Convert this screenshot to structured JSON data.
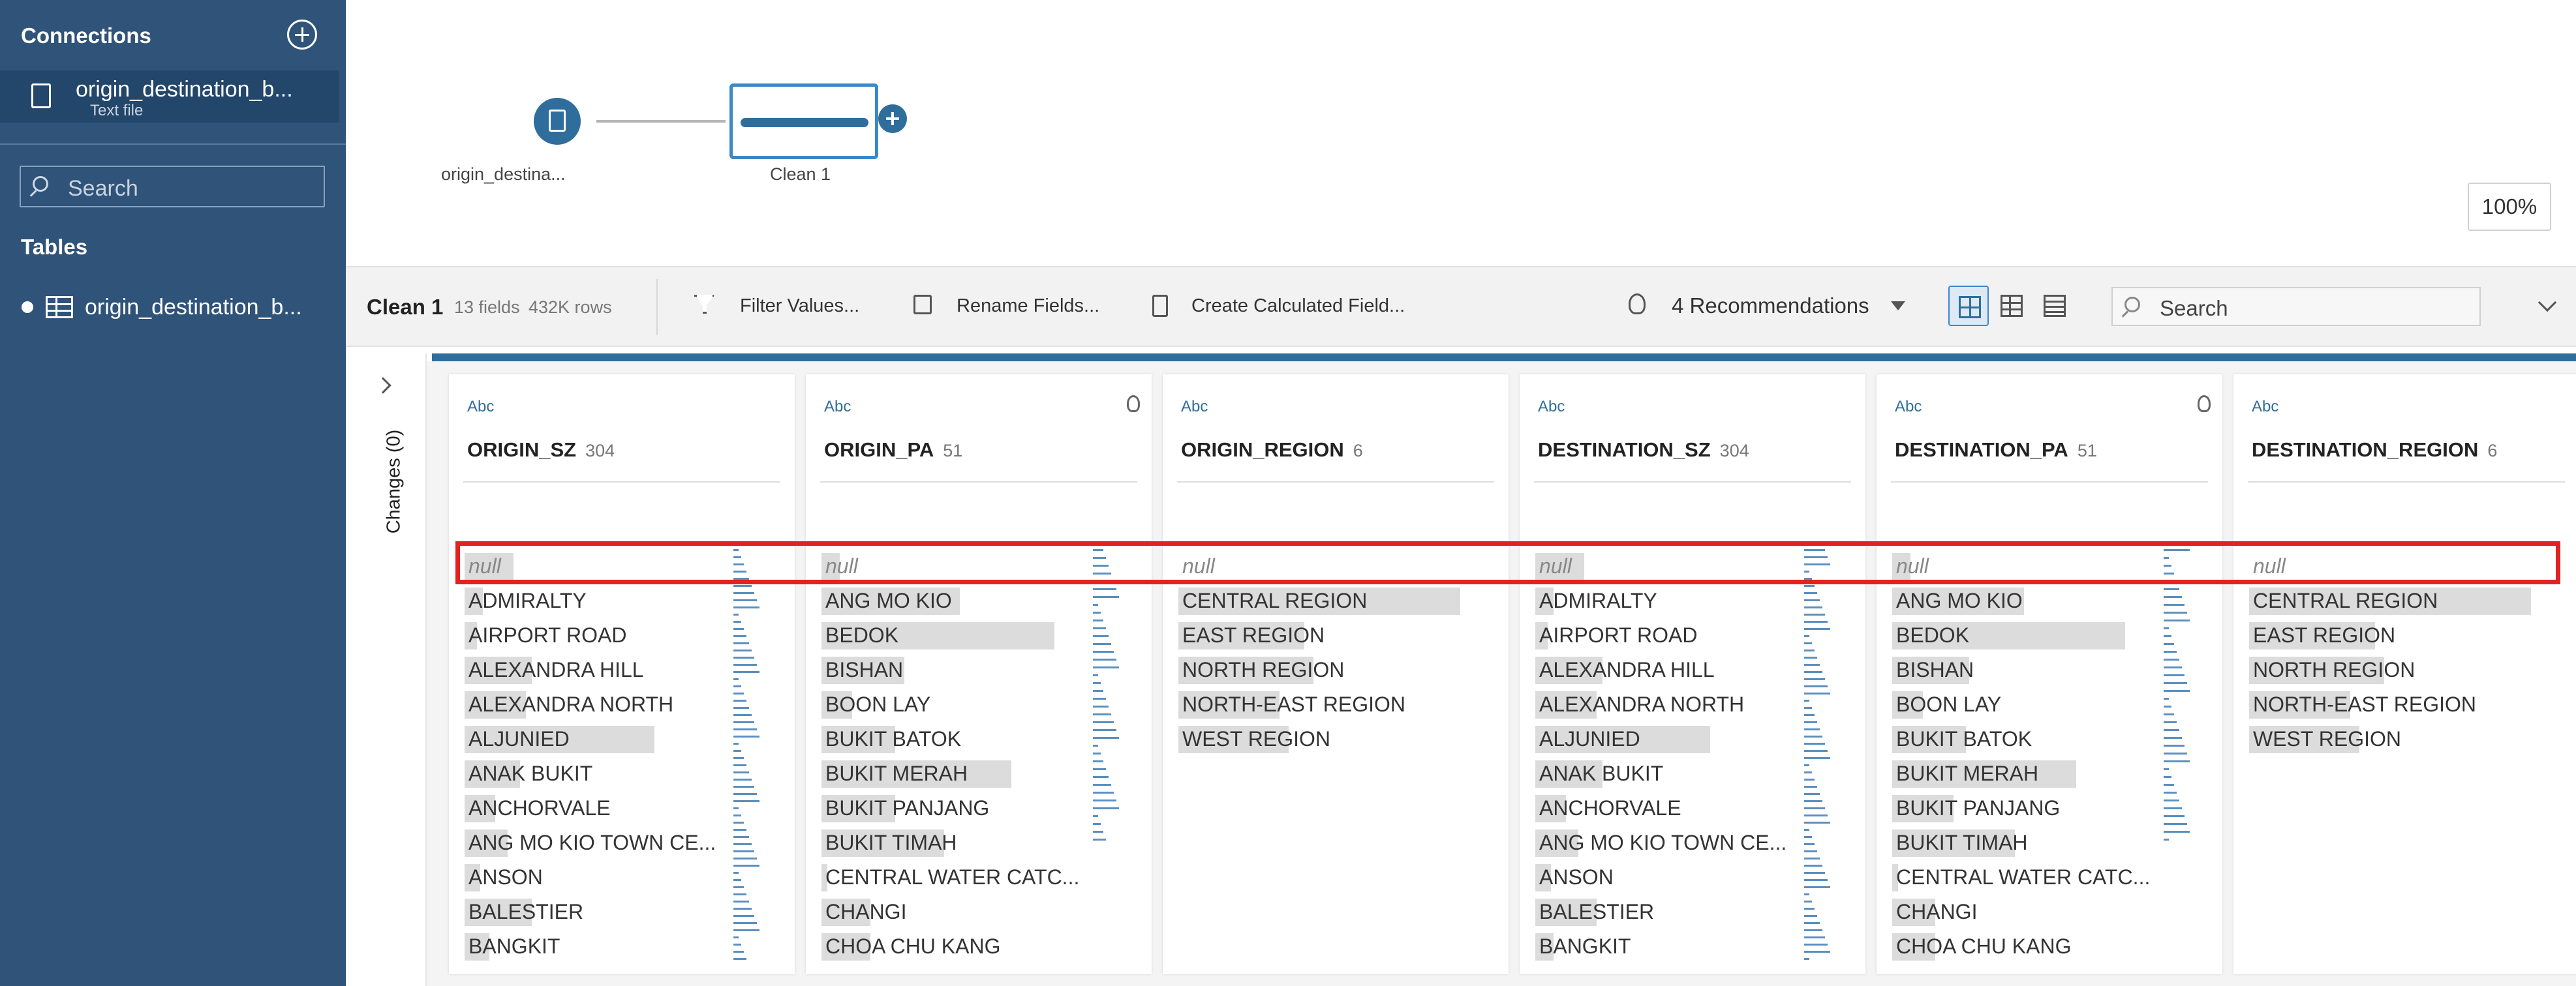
{
  "sidebar": {
    "connections_heading": "Connections",
    "connection_name": "origin_destination_b...",
    "connection_type": "Text file",
    "search_placeholder": "Search",
    "tables_heading": "Tables",
    "table_name": "origin_destination_b..."
  },
  "canvas": {
    "source_node_label": "origin_destina...",
    "clean_node_label": "Clean 1",
    "zoom": "100%"
  },
  "toolbar": {
    "step_name": "Clean 1",
    "fields": "13 fields",
    "rows": "432K rows",
    "filter_label": "Filter Values...",
    "rename_label": "Rename Fields...",
    "calc_label": "Create Calculated Field...",
    "recommendations_label": "4 Recommendations",
    "search_placeholder": "Search"
  },
  "changes": {
    "label": "Changes (0)"
  },
  "colors": {
    "sidebar": "#2f5379",
    "accent": "#2f6e9c",
    "highlight": "#e32121"
  },
  "fields": [
    {
      "type": "Abc",
      "name": "ORIGIN_SZ",
      "count": "304",
      "recommend": false,
      "values": [
        "null",
        "ADMIRALTY",
        "AIRPORT ROAD",
        "ALEXANDRA HILL",
        "ALEXANDRA NORTH",
        "ALJUNIED",
        "ANAK BUKIT",
        "ANCHORVALE",
        "ANG MO KIO TOWN CE...",
        "ANSON",
        "BALESTIER",
        "BANGKIT"
      ],
      "bars": [
        0.16,
        0.06,
        0.04,
        0.22,
        0.2,
        0.62,
        0.18,
        0.1,
        0.14,
        0.05,
        0.22,
        0.08
      ]
    },
    {
      "type": "Abc",
      "name": "ORIGIN_PA",
      "count": "51",
      "recommend": true,
      "values": [
        "null",
        "ANG MO KIO",
        "BEDOK",
        "BISHAN",
        "BOON LAY",
        "BUKIT BATOK",
        "BUKIT MERAH",
        "BUKIT PANJANG",
        "BUKIT TIMAH",
        "CENTRAL WATER CATC...",
        "CHANGI",
        "CHOA CHU KANG"
      ],
      "bars": [
        0.06,
        0.45,
        0.76,
        0.27,
        0.1,
        0.24,
        0.62,
        0.24,
        0.4,
        0.02,
        0.16,
        0.16
      ]
    },
    {
      "type": "Abc",
      "name": "ORIGIN_REGION",
      "count": "6",
      "recommend": false,
      "values": [
        "null",
        "CENTRAL REGION",
        "EAST REGION",
        "NORTH REGION",
        "NORTH-EAST REGION",
        "WEST REGION"
      ],
      "bars": [
        0.0,
        0.92,
        0.41,
        0.44,
        0.33,
        0.36
      ]
    },
    {
      "type": "Abc",
      "name": "DESTINATION_SZ",
      "count": "304",
      "recommend": false,
      "values": [
        "null",
        "ADMIRALTY",
        "AIRPORT ROAD",
        "ALEXANDRA HILL",
        "ALEXANDRA NORTH",
        "ALJUNIED",
        "ANAK BUKIT",
        "ANCHORVALE",
        "ANG MO KIO TOWN CE...",
        "ANSON",
        "BALESTIER",
        "BANGKIT"
      ],
      "bars": [
        0.16,
        0.06,
        0.04,
        0.22,
        0.2,
        0.57,
        0.22,
        0.1,
        0.14,
        0.05,
        0.2,
        0.06
      ]
    },
    {
      "type": "Abc",
      "name": "DESTINATION_PA",
      "count": "51",
      "recommend": true,
      "values": [
        "null",
        "ANG MO KIO",
        "BEDOK",
        "BISHAN",
        "BOON LAY",
        "BUKIT BATOK",
        "BUKIT MERAH",
        "BUKIT PANJANG",
        "BUKIT TIMAH",
        "CENTRAL WATER CATC...",
        "CHANGI",
        "CHOA CHU KANG"
      ],
      "bars": [
        0.06,
        0.43,
        0.76,
        0.25,
        0.1,
        0.24,
        0.6,
        0.2,
        0.4,
        0.02,
        0.14,
        0.14
      ]
    },
    {
      "type": "Abc",
      "name": "DESTINATION_REGION",
      "count": "6",
      "recommend": false,
      "values": [
        "null",
        "CENTRAL REGION",
        "EAST REGION",
        "NORTH REGION",
        "NORTH-EAST REGION",
        "WEST REGION"
      ],
      "bars": [
        0.0,
        0.92,
        0.41,
        0.44,
        0.33,
        0.36
      ]
    }
  ]
}
